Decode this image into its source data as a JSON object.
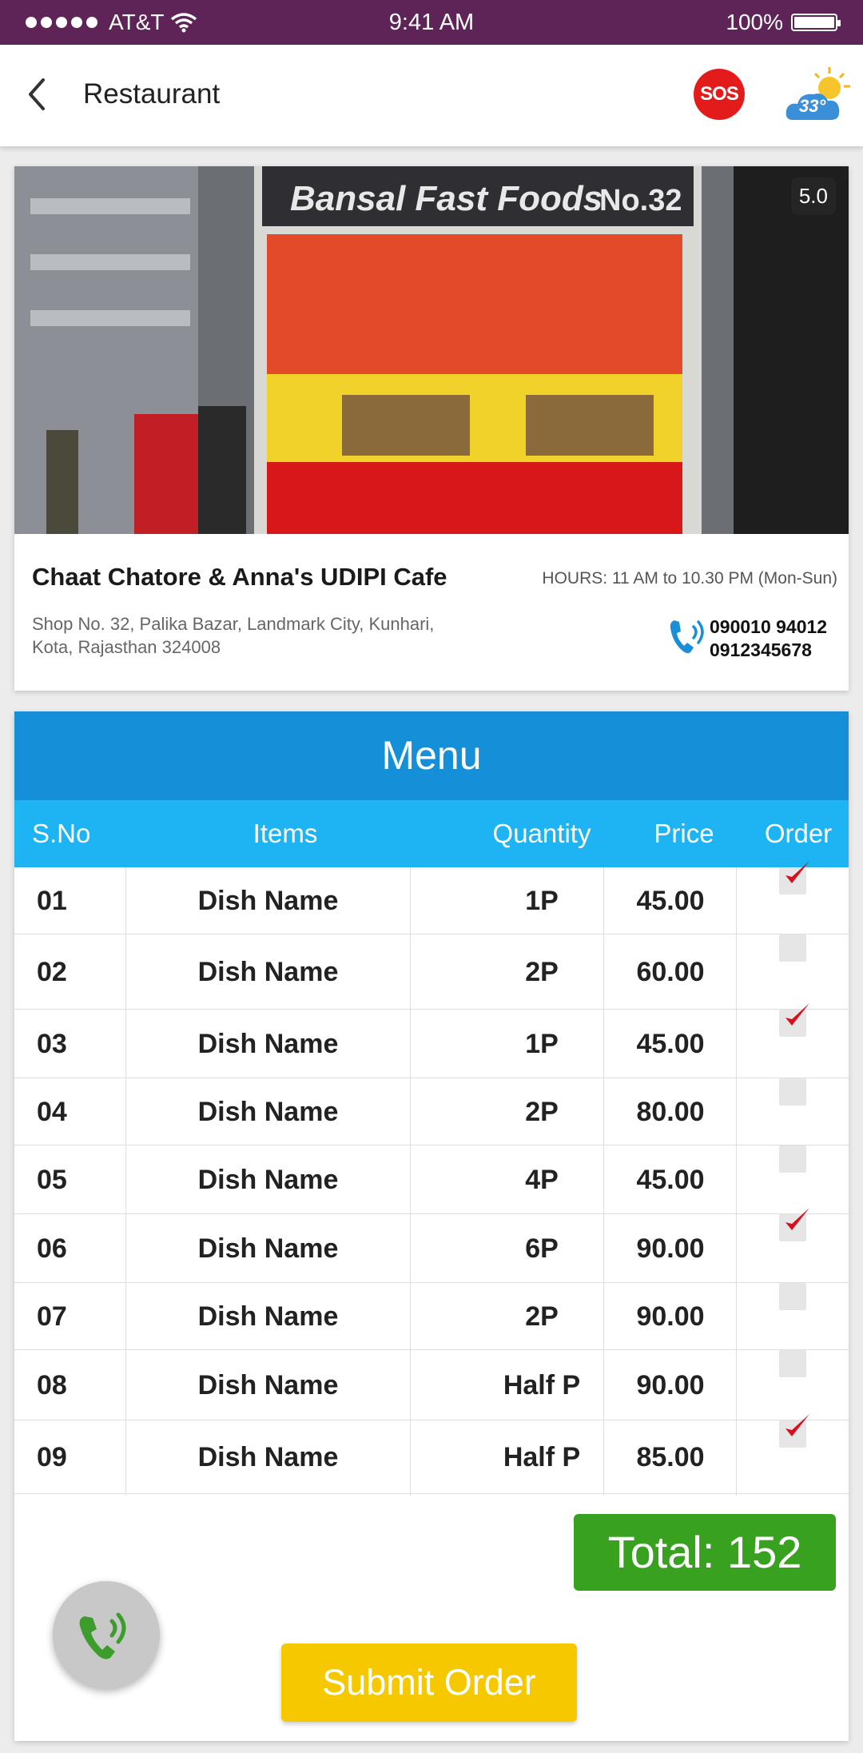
{
  "status_bar": {
    "carrier": "AT&T",
    "time": "9:41 AM",
    "battery": "100%"
  },
  "app_bar": {
    "title": "Restaurant",
    "sos_label": "SOS",
    "temperature": "33°"
  },
  "restaurant": {
    "photo_sign": "Bansal Fast Foods",
    "photo_sign_no": "No.32",
    "rating": "5.0",
    "name": "Chaat Chatore & Anna's UDIPI Cafe",
    "hours": "HOURS:  11 AM to 10.30 PM (Mon-Sun)",
    "address_line1": "Shop No. 32, Palika Bazar, Landmark City, Kunhari,",
    "address_line2": "Kota, Rajasthan 324008",
    "phone1": "090010 94012",
    "phone2": "0912345678"
  },
  "menu": {
    "title": "Menu",
    "headers": {
      "sno": "S.No",
      "items": "Items",
      "quantity": "Quantity",
      "price": "Price",
      "order": "Order"
    },
    "rows": [
      {
        "sno": "01",
        "item": "Dish Name",
        "quantity": "1P",
        "price": "45.00",
        "ordered": true
      },
      {
        "sno": "02",
        "item": "Dish Name",
        "quantity": "2P",
        "price": "60.00",
        "ordered": false
      },
      {
        "sno": "03",
        "item": "Dish Name",
        "quantity": "1P",
        "price": "45.00",
        "ordered": true
      },
      {
        "sno": "04",
        "item": "Dish Name",
        "quantity": "2P",
        "price": "80.00",
        "ordered": false
      },
      {
        "sno": "05",
        "item": "Dish Name",
        "quantity": "4P",
        "price": "45.00",
        "ordered": false
      },
      {
        "sno": "06",
        "item": "Dish Name",
        "quantity": "6P",
        "price": "90.00",
        "ordered": true
      },
      {
        "sno": "07",
        "item": "Dish Name",
        "quantity": "2P",
        "price": "90.00",
        "ordered": false
      },
      {
        "sno": "08",
        "item": "Dish Name",
        "quantity": "Half P",
        "price": "90.00",
        "ordered": false
      },
      {
        "sno": "09",
        "item": "Dish Name",
        "quantity": "Half P",
        "price": "85.00",
        "ordered": true
      }
    ],
    "total": "Total: 152",
    "submit_label": "Submit Order"
  },
  "colors": {
    "status_bar": "#5e2457",
    "menu_title": "#1590d8",
    "table_header": "#1eb3f3",
    "total": "#38a11f",
    "submit": "#f5c800",
    "sos": "#e41b1b"
  },
  "icons": [
    "back-arrow-icon",
    "sos-icon",
    "weather-icon",
    "phone-icon",
    "check-icon",
    "call-icon"
  ]
}
